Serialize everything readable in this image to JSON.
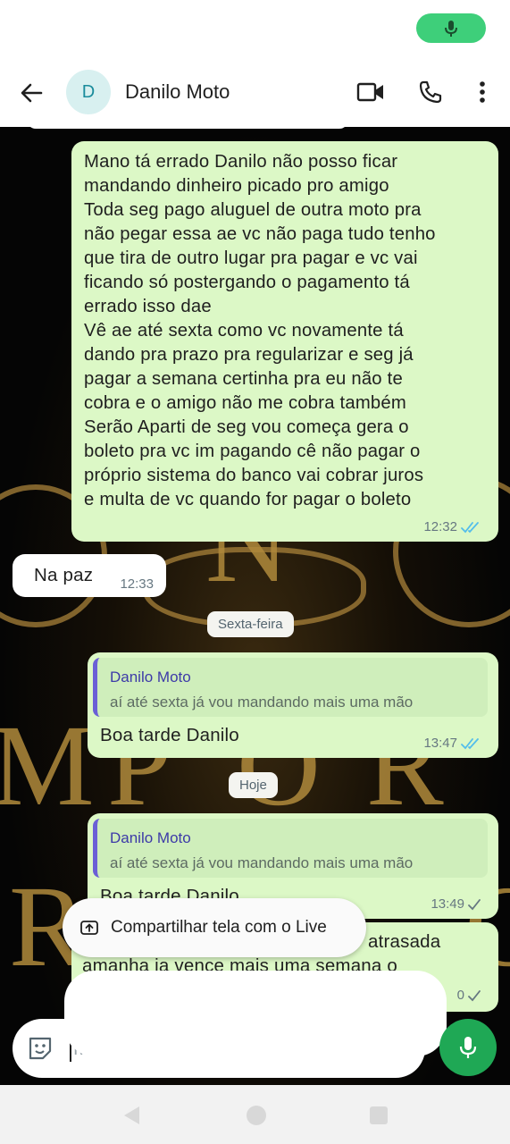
{
  "header": {
    "avatar_initial": "D",
    "contact_name": "Danilo Moto"
  },
  "messages": [
    {
      "text": "Mano tá errado Danilo não posso ficar\nmandando dinheiro picado pro amigo\nToda seg pago aluguel de outra moto pra\nnão pegar essa ae vc não paga tudo tenho\nque tira de outro lugar pra pagar e vc vai\nficando só postergando o pagamento tá\nerrado isso dae\nVê ae até sexta como vc novamente tá\ndando pra prazo pra regularizar e seg já\npagar a semana certinha pra eu não te\ncobra e o amigo não me cobra também\nSerão Aparti de seg vou começa gera o\nboleto pra vc im pagando cê não pagar o\npróprio sistema do banco vai cobrar juros\ne multa de vc quando for pagar o boleto",
      "time": "12:32"
    },
    {
      "text": "Na paz",
      "time": "12:33"
    },
    {
      "quote_name": "Danilo Moto",
      "quote_text": "aí até sexta já vou mandando mais uma mão",
      "text": "Boa tarde Danilo",
      "time": "13:47"
    },
    {
      "quote_name": "Danilo Moto",
      "quote_text": "aí até sexta já vou mandando mais uma mão",
      "text": "Boa tarde Danilo",
      "time": "13:49"
    },
    {
      "text_a": "atrasada",
      "text_b": "amanha ja vence mais uma semana o",
      "time": "0"
    }
  ],
  "dates": {
    "friday": "Sexta-feira",
    "today": "Hoje"
  },
  "overlay": {
    "share_label": "Compartilhar tela com o Live"
  },
  "input": {
    "placeholder": "M"
  },
  "wallpaper_letters": [
    "N",
    "M",
    "P",
    "O",
    "R",
    "R",
    "C"
  ],
  "colors": {
    "outgoing_bubble": "#dcf8c6",
    "incoming_bubble": "#ffffff",
    "read_ticks": "#53bdeb",
    "mic_green": "#1fa855",
    "accent_gold": "#b08a3c"
  }
}
